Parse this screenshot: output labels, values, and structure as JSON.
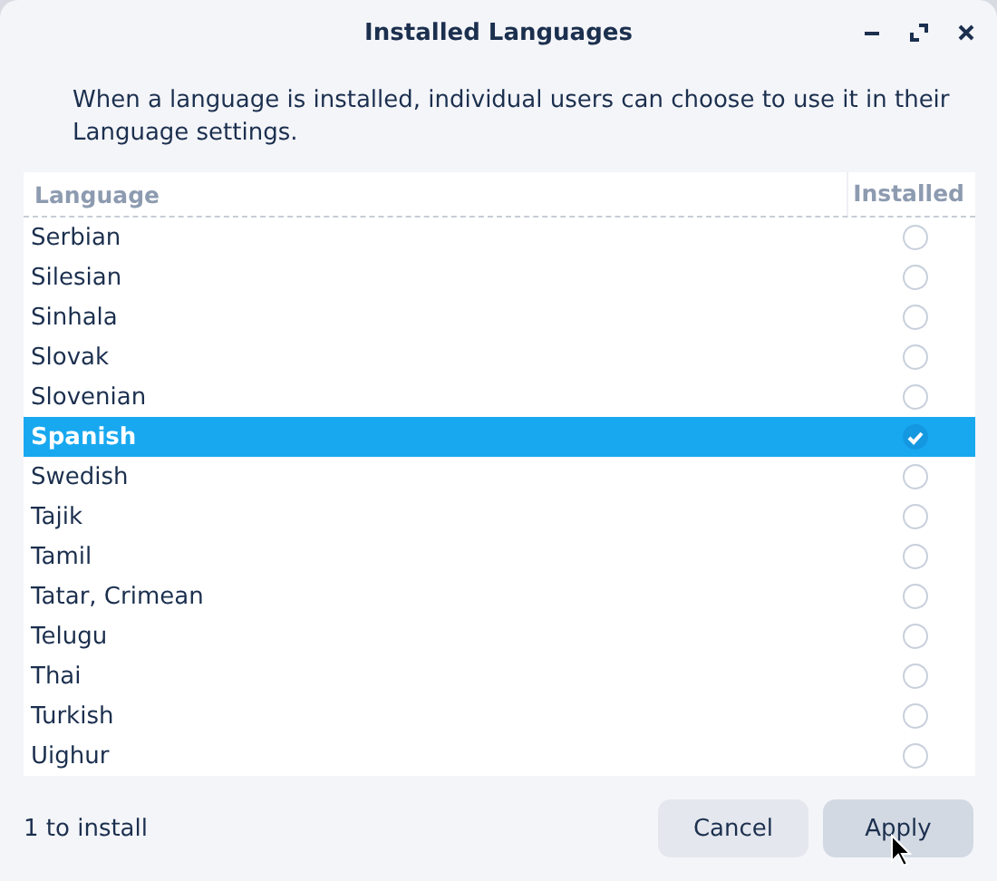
{
  "window": {
    "title": "Installed Languages"
  },
  "description": "When a language is installed, individual users can choose to use it in their Language settings.",
  "table": {
    "columns": [
      "Language",
      "Installed"
    ],
    "rows": [
      {
        "name": "Serbian",
        "installed": false,
        "selected": false
      },
      {
        "name": "Silesian",
        "installed": false,
        "selected": false
      },
      {
        "name": "Sinhala",
        "installed": false,
        "selected": false
      },
      {
        "name": "Slovak",
        "installed": false,
        "selected": false
      },
      {
        "name": "Slovenian",
        "installed": false,
        "selected": false
      },
      {
        "name": "Spanish",
        "installed": true,
        "selected": true
      },
      {
        "name": "Swedish",
        "installed": false,
        "selected": false
      },
      {
        "name": "Tajik",
        "installed": false,
        "selected": false
      },
      {
        "name": "Tamil",
        "installed": false,
        "selected": false
      },
      {
        "name": "Tatar, Crimean",
        "installed": false,
        "selected": false
      },
      {
        "name": "Telugu",
        "installed": false,
        "selected": false
      },
      {
        "name": "Thai",
        "installed": false,
        "selected": false
      },
      {
        "name": "Turkish",
        "installed": false,
        "selected": false
      },
      {
        "name": "Uighur",
        "installed": false,
        "selected": false
      }
    ]
  },
  "status": "1 to install",
  "buttons": [
    "Cancel",
    "Apply"
  ]
}
